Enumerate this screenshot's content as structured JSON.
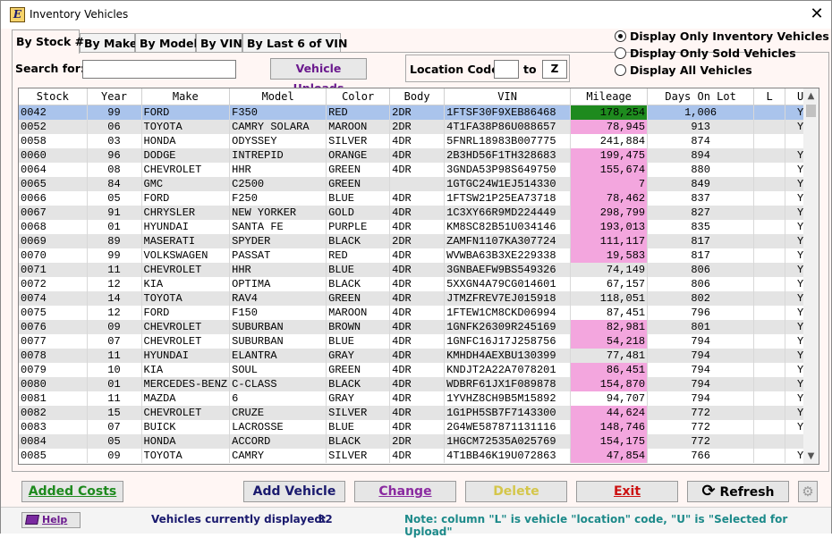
{
  "window": {
    "title": "Inventory Vehicles",
    "app_icon_letter": "E"
  },
  "tabs": [
    {
      "label": "By Stock #",
      "active": true
    },
    {
      "label": "By Make",
      "active": false
    },
    {
      "label": "By Model",
      "active": false
    },
    {
      "label": "By VIN",
      "active": false
    },
    {
      "label": "By Last 6 of VIN",
      "active": false
    }
  ],
  "display_options": [
    {
      "label": "Display Only Inventory Vehicles",
      "selected": true
    },
    {
      "label": "Display Only Sold Vehicles",
      "selected": false
    },
    {
      "label": "Display All Vehicles",
      "selected": false
    }
  ],
  "search": {
    "label": "Search for:",
    "value": ""
  },
  "uploads_button": "Vehicle Uploads",
  "location": {
    "label": "Location Code",
    "from": "",
    "to_label": "to",
    "to": "Z"
  },
  "grid": {
    "columns": [
      "Stock",
      "Year",
      "Make",
      "Model",
      "Color",
      "Body",
      "VIN",
      "Mileage",
      "Days On Lot",
      "L",
      "U"
    ],
    "rows": [
      [
        "0042",
        "99",
        "FORD",
        "F350",
        "RED",
        "2DR",
        "1FTSF30F9XEB86468",
        "178,254",
        "1,006",
        "",
        "Y"
      ],
      [
        "0052",
        "06",
        "TOYOTA",
        "CAMRY SOLARA",
        "MAROON",
        "2DR",
        "4T1FA38P86U088657",
        "78,945",
        "913",
        "",
        "Y"
      ],
      [
        "0058",
        "03",
        "HONDA",
        "ODYSSEY",
        "SILVER",
        "4DR",
        "5FNRL18983B007775",
        "241,884",
        "874",
        "",
        ""
      ],
      [
        "0060",
        "96",
        "DODGE",
        "INTREPID",
        "ORANGE",
        "4DR",
        "2B3HD56F1TH328683",
        "199,475",
        "894",
        "",
        "Y"
      ],
      [
        "0064",
        "08",
        "CHEVROLET",
        "HHR",
        "GREEN",
        "4DR",
        "3GNDA53P98S649750",
        "155,674",
        "880",
        "",
        "Y"
      ],
      [
        "0065",
        "84",
        "GMC",
        "C2500",
        "GREEN",
        "",
        "1GTGC24W1EJ514330",
        "7",
        "849",
        "",
        "Y"
      ],
      [
        "0066",
        "05",
        "FORD",
        "F250",
        "BLUE",
        "4DR",
        "1FTSW21P25EA73718",
        "78,462",
        "837",
        "",
        "Y"
      ],
      [
        "0067",
        "91",
        "CHRYSLER",
        "NEW YORKER",
        "GOLD",
        "4DR",
        "1C3XY66R9MD224449",
        "298,799",
        "827",
        "",
        "Y"
      ],
      [
        "0068",
        "01",
        "HYUNDAI",
        "SANTA FE",
        "PURPLE",
        "4DR",
        "KM8SC82B51U034146",
        "193,013",
        "835",
        "",
        "Y"
      ],
      [
        "0069",
        "89",
        "MASERATI",
        "SPYDER",
        "BLACK",
        "2DR",
        "ZAMFN1107KA307724",
        "111,117",
        "817",
        "",
        "Y"
      ],
      [
        "0070",
        "99",
        "VOLKSWAGEN",
        "PASSAT",
        "RED",
        "4DR",
        "WVWBA63B3XE229338",
        "19,583",
        "817",
        "",
        "Y"
      ],
      [
        "0071",
        "11",
        "CHEVROLET",
        "HHR",
        "BLUE",
        "4DR",
        "3GNBAEFW9BS549326",
        "74,149",
        "806",
        "",
        "Y"
      ],
      [
        "0072",
        "12",
        "KIA",
        "OPTIMA",
        "BLACK",
        "4DR",
        "5XXGN4A79CG014601",
        "67,157",
        "806",
        "",
        "Y"
      ],
      [
        "0074",
        "14",
        "TOYOTA",
        "RAV4",
        "GREEN",
        "4DR",
        "JTMZFREV7EJ015918",
        "118,051",
        "802",
        "",
        "Y"
      ],
      [
        "0075",
        "12",
        "FORD",
        "F150",
        "MAROON",
        "4DR",
        "1FTEW1CM8CKD06994",
        "87,451",
        "796",
        "",
        "Y"
      ],
      [
        "0076",
        "09",
        "CHEVROLET",
        "SUBURBAN",
        "BROWN",
        "4DR",
        "1GNFK26309R245169",
        "82,981",
        "801",
        "",
        "Y"
      ],
      [
        "0077",
        "07",
        "CHEVROLET",
        "SUBURBAN",
        "BLUE",
        "4DR",
        "1GNFC16J17J258756",
        "54,218",
        "794",
        "",
        "Y"
      ],
      [
        "0078",
        "11",
        "HYUNDAI",
        "ELANTRA",
        "GRAY",
        "4DR",
        "KMHDH4AEXBU130399",
        "77,481",
        "794",
        "",
        "Y"
      ],
      [
        "0079",
        "10",
        "KIA",
        "SOUL",
        "GREEN",
        "4DR",
        "KNDJT2A22A7078201",
        "86,451",
        "794",
        "",
        "Y"
      ],
      [
        "0080",
        "01",
        "MERCEDES-BENZ",
        "C-CLASS",
        "BLACK",
        "4DR",
        "WDBRF61JX1F089878",
        "154,870",
        "794",
        "",
        "Y"
      ],
      [
        "0081",
        "11",
        "MAZDA",
        "6",
        "GRAY",
        "4DR",
        "1YVHZ8CH9B5M15892",
        "94,707",
        "794",
        "",
        "Y"
      ],
      [
        "0082",
        "15",
        "CHEVROLET",
        "CRUZE",
        "SILVER",
        "4DR",
        "1G1PH5SB7F7143300",
        "44,624",
        "772",
        "",
        "Y"
      ],
      [
        "0083",
        "07",
        "BUICK",
        "LACROSSE",
        "BLUE",
        "4DR",
        "2G4WE587871131116",
        "148,746",
        "772",
        "",
        "Y"
      ],
      [
        "0084",
        "05",
        "HONDA",
        "ACCORD",
        "BLACK",
        "2DR",
        "1HGCM72535A025769",
        "154,175",
        "772",
        "",
        ""
      ],
      [
        "0085",
        "09",
        "TOYOTA",
        "CAMRY",
        "SILVER",
        "4DR",
        "4T1BB46K19U072863",
        "47,854",
        "766",
        "",
        "Y"
      ]
    ],
    "mileage_highlight": [
      "green",
      "pink",
      "",
      "pink",
      "pink",
      "pink",
      "pink",
      "pink",
      "pink",
      "pink",
      "pink",
      "",
      "",
      "",
      "",
      "pink",
      "pink",
      "",
      "pink",
      "pink",
      "",
      "pink",
      "pink",
      "pink",
      "pink"
    ],
    "colors": {
      "selected_row": "#aac4ec",
      "alt_row": "#e4e4e4",
      "pink": "#f3a6de",
      "green": "#1e8a1e"
    }
  },
  "buttons": {
    "added_costs": "Added Costs",
    "add_vehicle": "Add Vehicle",
    "change": "Change",
    "delete": "Delete",
    "exit": "Exit",
    "refresh": "Refresh"
  },
  "footer": {
    "help": "Help",
    "count_label": "Vehicles currently displayed:",
    "count": "32",
    "note": "Note: column \"L\" is vehicle \"location\" code, \"U\" is \"Selected for Upload\""
  }
}
